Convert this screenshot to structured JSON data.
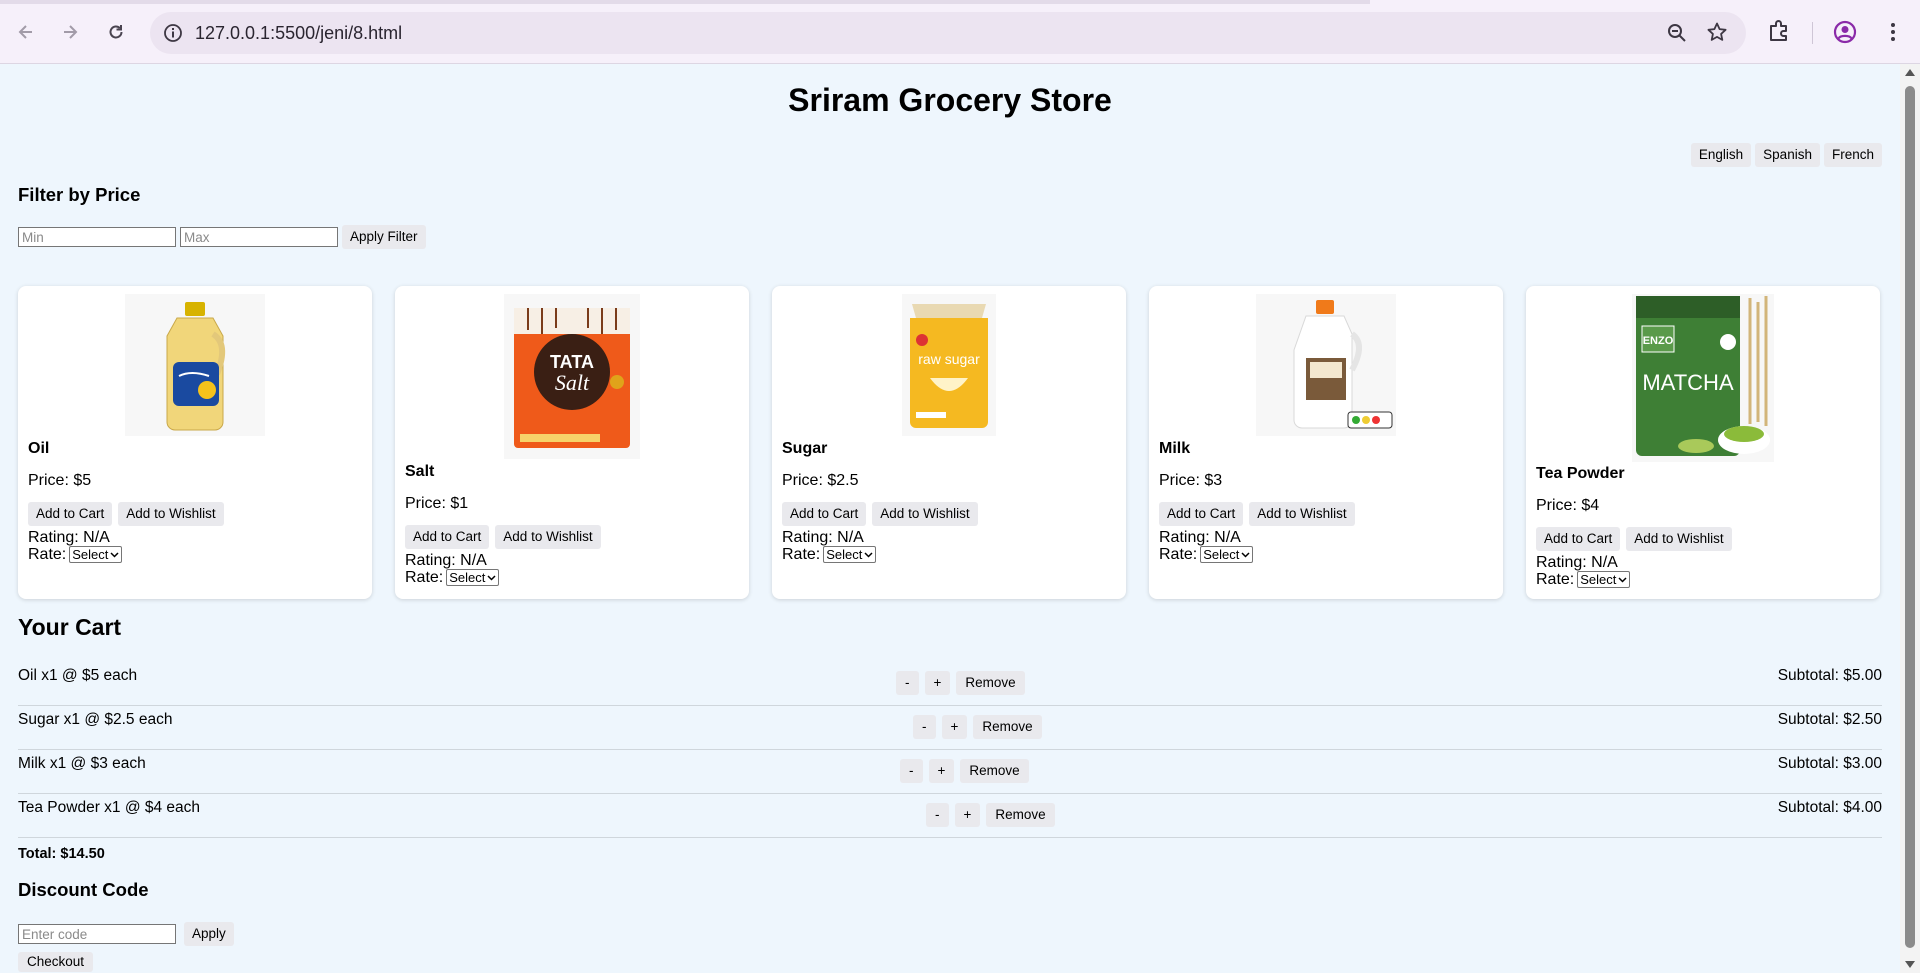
{
  "browser": {
    "url": "127.0.0.1:5500/jeni/8.html"
  },
  "store": {
    "title": "Sriram Grocery Store"
  },
  "languages": [
    "English",
    "Spanish",
    "French"
  ],
  "filter": {
    "heading": "Filter by Price",
    "min_placeholder": "Min",
    "max_placeholder": "Max",
    "apply_label": "Apply Filter"
  },
  "products": [
    {
      "name": "Oil",
      "price": "Price: $5",
      "add_cart": "Add to Cart",
      "add_wishlist": "Add to Wishlist",
      "rating": "Rating: N/A",
      "rate_label": "Rate:",
      "select": "Select"
    },
    {
      "name": "Salt",
      "price": "Price: $1",
      "add_cart": "Add to Cart",
      "add_wishlist": "Add to Wishlist",
      "rating": "Rating: N/A",
      "rate_label": "Rate:",
      "select": "Select"
    },
    {
      "name": "Sugar",
      "price": "Price: $2.5",
      "add_cart": "Add to Cart",
      "add_wishlist": "Add to Wishlist",
      "rating": "Rating: N/A",
      "rate_label": "Rate:",
      "select": "Select"
    },
    {
      "name": "Milk",
      "price": "Price: $3",
      "add_cart": "Add to Cart",
      "add_wishlist": "Add to Wishlist",
      "rating": "Rating: N/A",
      "rate_label": "Rate:",
      "select": "Select"
    },
    {
      "name": "Tea Powder",
      "price": "Price: $4",
      "add_cart": "Add to Cart",
      "add_wishlist": "Add to Wishlist",
      "rating": "Rating: N/A",
      "rate_label": "Rate:",
      "select": "Select"
    }
  ],
  "product_images": {
    "salt_brand": "TATA",
    "salt_word": "Salt",
    "sugar_text": "raw sugar",
    "tea_brand": "ENZO",
    "tea_word": "MATCHA"
  },
  "cart": {
    "heading": "Your Cart",
    "items": [
      {
        "desc": "Oil x1 @ $5 each",
        "minus": "-",
        "plus": "+",
        "remove": "Remove",
        "subtotal": "Subtotal: $5.00"
      },
      {
        "desc": "Sugar x1 @ $2.5 each",
        "minus": "-",
        "plus": "+",
        "remove": "Remove",
        "subtotal": "Subtotal: $2.50"
      },
      {
        "desc": "Milk x1 @ $3 each",
        "minus": "-",
        "plus": "+",
        "remove": "Remove",
        "subtotal": "Subtotal: $3.00"
      },
      {
        "desc": "Tea Powder x1 @ $4 each",
        "minus": "-",
        "plus": "+",
        "remove": "Remove",
        "subtotal": "Subtotal: $4.00"
      }
    ],
    "total": "Total: $14.50"
  },
  "discount": {
    "heading": "Discount Code",
    "placeholder": "Enter code",
    "apply_label": "Apply"
  },
  "checkout_label": "Checkout",
  "colors": {
    "page_bg": "#eef6fd",
    "card_bg": "#ffffff",
    "button_bg": "#e9e9ed"
  }
}
